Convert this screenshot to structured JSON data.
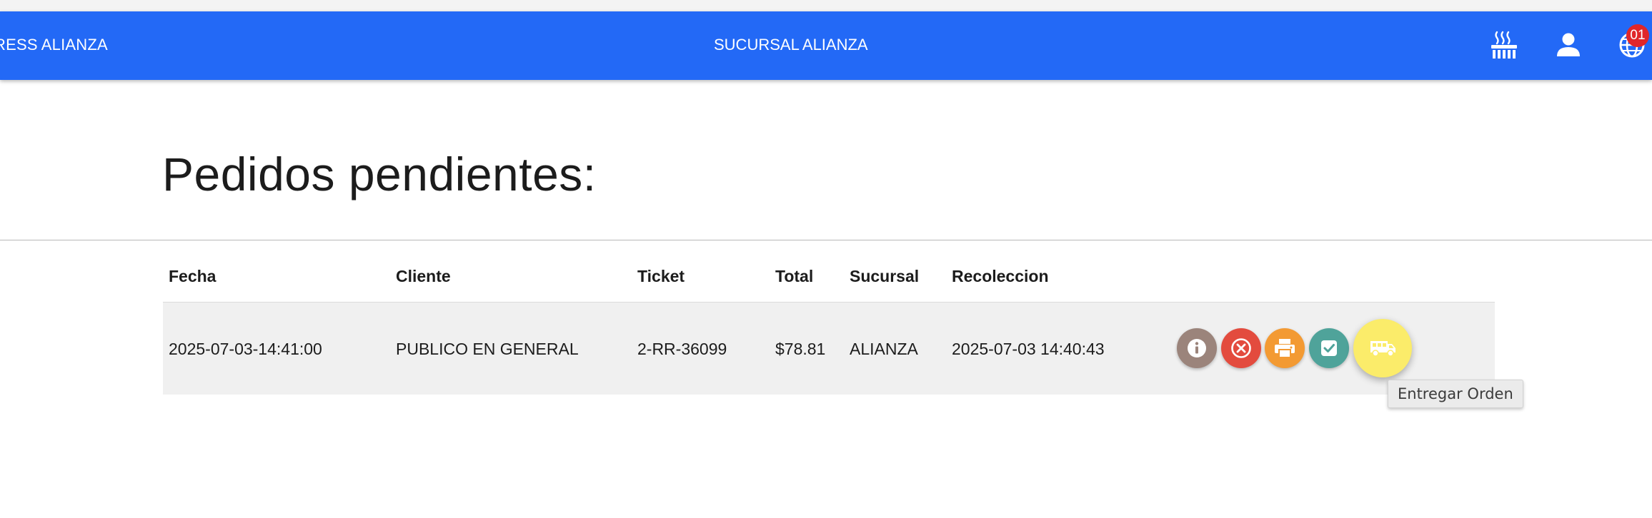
{
  "header": {
    "brand": "RESS ALIANZA",
    "branch": "SUCURSAL ALIANZA",
    "notification_count": "01",
    "icons": [
      "kitchen-icon",
      "user-icon",
      "globe-icon"
    ],
    "bar_color": "#2369f6"
  },
  "page": {
    "title": "Pedidos pendientes:"
  },
  "table": {
    "columns": [
      "Fecha",
      "Cliente",
      "Ticket",
      "Total",
      "Sucursal",
      "Recoleccion"
    ],
    "rows": [
      {
        "fecha": "2025-07-03-14:41:00",
        "cliente": "PUBLICO EN GENERAL",
        "ticket": "2-RR-36099",
        "total": "$78.81",
        "sucursal": "ALIANZA",
        "recoleccion": "2025-07-03 14:40:43"
      }
    ],
    "actions": [
      {
        "name": "info",
        "icon": "info-icon",
        "color": "#9b847b"
      },
      {
        "name": "cancel",
        "icon": "cancel-icon",
        "color": "#e34b3e"
      },
      {
        "name": "print",
        "icon": "printer-icon",
        "color": "#f39a33"
      },
      {
        "name": "complete",
        "icon": "check-icon",
        "color": "#4fa39a"
      },
      {
        "name": "deliver",
        "icon": "van-icon",
        "color": "#fbec6a"
      }
    ]
  },
  "tooltip": {
    "text": "Entregar Orden"
  }
}
